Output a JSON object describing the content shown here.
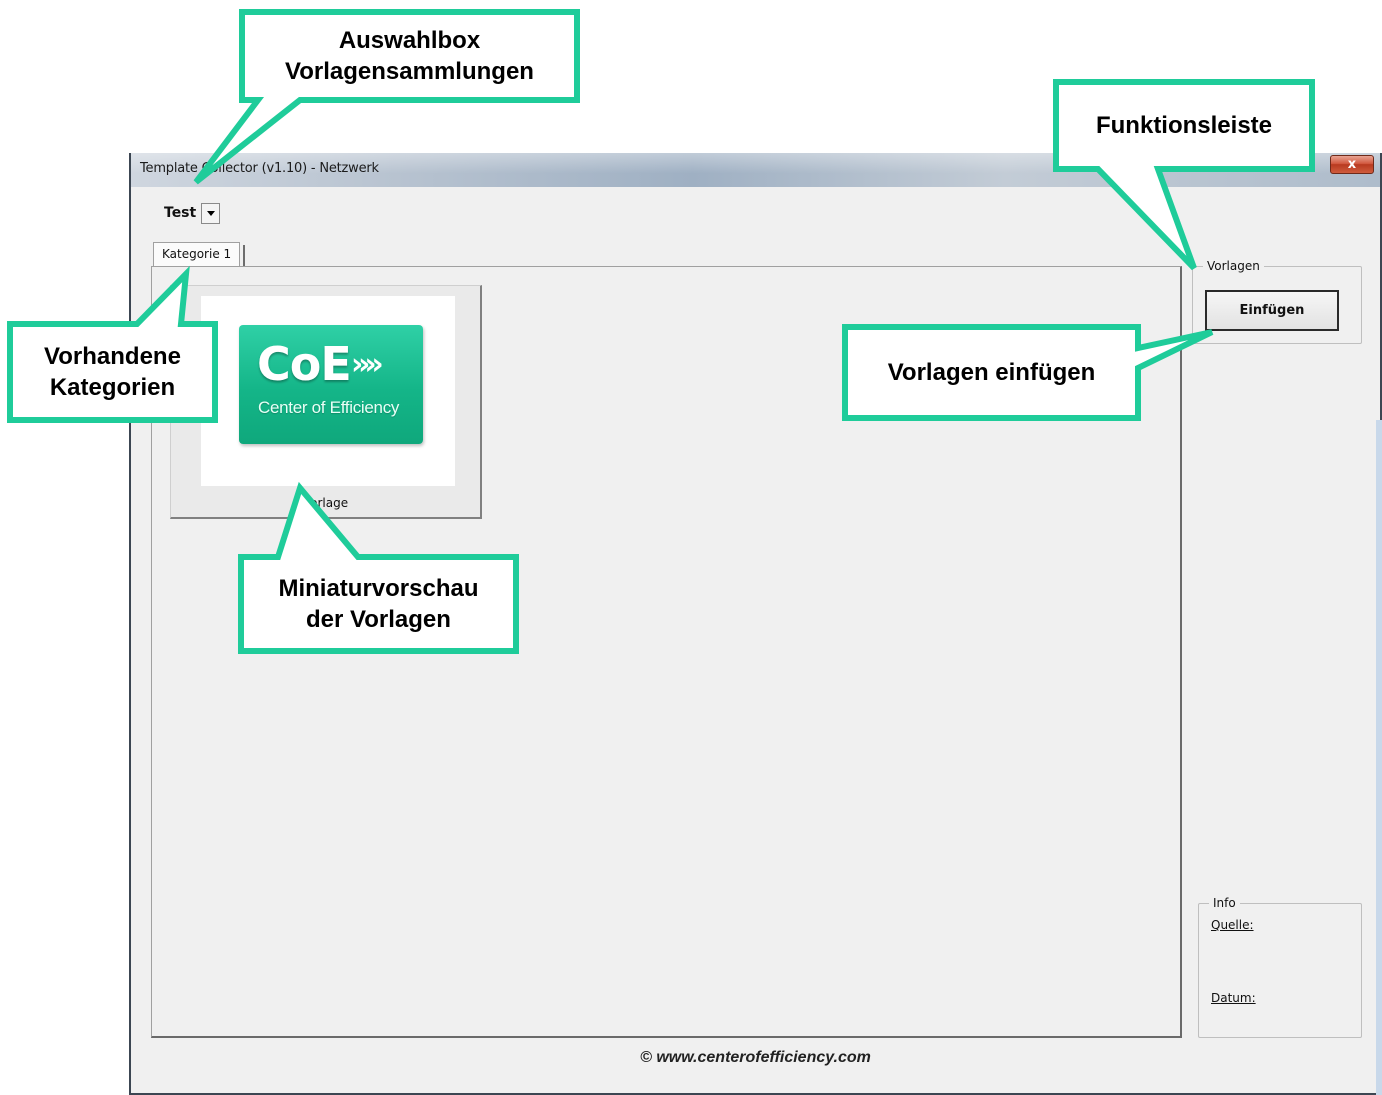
{
  "window": {
    "title": "Template Collector (v1.10) - Netzwerk",
    "close_label": "x"
  },
  "collection": {
    "selected": "Test"
  },
  "tabs": [
    {
      "label": "Kategorie 1",
      "active": true
    }
  ],
  "templates": [
    {
      "caption": "Vorlage",
      "logo_main": "CoE",
      "logo_arrows": "»»",
      "logo_sub": "Center of Efficiency"
    }
  ],
  "vorlagen_group": {
    "legend": "Vorlagen",
    "insert_button": "Einfügen"
  },
  "info_group": {
    "legend": "Info",
    "source_label": "Quelle:",
    "date_label": "Datum:"
  },
  "footer": "© www.centerofefficiency.com",
  "callouts": {
    "selector": "Auswahlbox\nVorlagensammlungen",
    "toolbar": "Funktionsleiste",
    "categories": "Vorhandene\nKategorien",
    "insert": "Vorlagen einfügen",
    "thumbnails": "Miniaturvorschau\nder Vorlagen"
  },
  "colors": {
    "callout_border": "#1fcc9a",
    "logo_green": "#14b588",
    "window_bg": "#f0f0f0"
  }
}
